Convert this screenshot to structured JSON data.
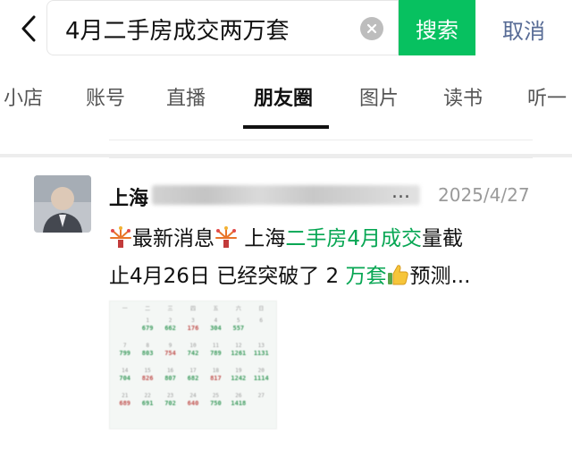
{
  "search": {
    "query": "4月二手房成交两万套",
    "button_label": "搜索",
    "cancel_label": "取消"
  },
  "tabs": [
    {
      "label": "小店",
      "active": false
    },
    {
      "label": "账号",
      "active": false
    },
    {
      "label": "直播",
      "active": false
    },
    {
      "label": "朋友圈",
      "active": true
    },
    {
      "label": "图片",
      "active": false
    },
    {
      "label": "读书",
      "active": false
    },
    {
      "label": "听一",
      "active": false
    }
  ],
  "post": {
    "author_prefix": "上海",
    "author_ellipsis": "...",
    "date": "2025/4/27",
    "line1": [
      {
        "t": "最新消息",
        "hl": false,
        "emoji_before": "fireworks-icon",
        "emoji_after": "fireworks-icon"
      },
      {
        "t": " 上海",
        "hl": false
      },
      {
        "t": "二手房4月成交",
        "hl": true
      },
      {
        "t": "量截",
        "hl": false
      }
    ],
    "line2": [
      {
        "t": "止4月26日 已经突破了 2 ",
        "hl": false
      },
      {
        "t": "万套",
        "hl": true
      },
      {
        "t": "预测...",
        "hl": false,
        "emoji_before": "thumbs-up-icon"
      }
    ]
  },
  "calendar_image": {
    "weekday_headers": [
      "一",
      "二",
      "三",
      "四",
      "五",
      "六",
      "日"
    ],
    "weeks": [
      {
        "days": [
          "",
          "1",
          "2",
          "3",
          "4",
          "5",
          "6"
        ],
        "values": [
          "",
          "679",
          "662",
          "176",
          "304",
          "557",
          ""
        ]
      },
      {
        "days": [
          "7",
          "8",
          "9",
          "10",
          "11",
          "12",
          "13"
        ],
        "values": [
          "799",
          "803",
          "754",
          "742",
          "789",
          "1261",
          "1131"
        ]
      },
      {
        "days": [
          "14",
          "15",
          "16",
          "17",
          "18",
          "19",
          "20"
        ],
        "values": [
          "704",
          "826",
          "807",
          "682",
          "817",
          "1242",
          "1114"
        ]
      },
      {
        "days": [
          "21",
          "22",
          "23",
          "24",
          "25",
          "26",
          "27"
        ],
        "values": [
          "689",
          "691",
          "702",
          "640",
          "750",
          "1418",
          ""
        ]
      }
    ]
  },
  "colors": {
    "accent_green": "#07c160",
    "highlight_green": "#07a653",
    "link_blue": "#576b95",
    "date_gray": "#9a9a9a"
  }
}
